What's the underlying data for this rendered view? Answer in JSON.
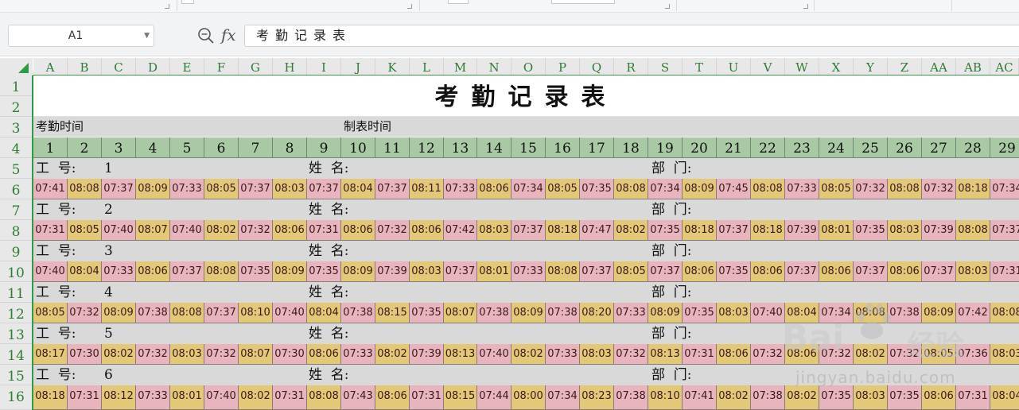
{
  "formula_bar": {
    "cell_ref": "A1",
    "content": "考勤记录表"
  },
  "icons": {
    "zoom": "zoom-in-icon",
    "fx": "function-icon",
    "dropdown": "chevron-down-icon"
  },
  "grid": {
    "columns": [
      "A",
      "B",
      "C",
      "D",
      "E",
      "F",
      "G",
      "H",
      "I",
      "J",
      "K",
      "L",
      "M",
      "N",
      "O",
      "P",
      "Q",
      "R",
      "S",
      "T",
      "U",
      "V",
      "W",
      "X",
      "Y",
      "Z",
      "AA",
      "AB",
      "AC"
    ],
    "rows": [
      "1",
      "2",
      "3",
      "4",
      "5",
      "6",
      "7",
      "8",
      "9",
      "10",
      "11",
      "12",
      "13",
      "14",
      "15",
      "16"
    ]
  },
  "sheet": {
    "title": "考勤记录表",
    "attendance_time_label": "考勤时间",
    "created_time_label": "制表时间",
    "days": [
      "1",
      "2",
      "3",
      "4",
      "5",
      "6",
      "7",
      "8",
      "9",
      "10",
      "11",
      "12",
      "13",
      "14",
      "15",
      "16",
      "17",
      "18",
      "19",
      "20",
      "21",
      "22",
      "23",
      "24",
      "25",
      "26",
      "27",
      "28",
      "29"
    ],
    "id_label": "工  号:",
    "name_label": "姓  名:",
    "dept_label": "部  门:",
    "employees": [
      {
        "id": "1",
        "times": [
          "07:41",
          "08:08",
          "07:37",
          "08:09",
          "07:33",
          "08:05",
          "07:37",
          "08:03",
          "07:37",
          "08:04",
          "07:37",
          "08:11",
          "07:33",
          "08:06",
          "07:34",
          "08:05",
          "07:35",
          "08:08",
          "07:34",
          "08:09",
          "07:45",
          "08:08",
          "07:33",
          "08:05",
          "07:32",
          "08:08",
          "07:32",
          "08:18",
          "07:34"
        ]
      },
      {
        "id": "2",
        "times": [
          "07:31",
          "08:05",
          "07:40",
          "08:07",
          "07:40",
          "08:02",
          "07:32",
          "08:06",
          "07:31",
          "08:06",
          "07:32",
          "08:06",
          "07:42",
          "08:03",
          "07:37",
          "08:18",
          "07:47",
          "08:02",
          "07:35",
          "08:18",
          "07:37",
          "08:18",
          "07:39",
          "08:01",
          "07:35",
          "08:03",
          "07:39",
          "08:08",
          "07:37"
        ]
      },
      {
        "id": "3",
        "times": [
          "07:40",
          "08:04",
          "07:33",
          "08:06",
          "07:37",
          "08:08",
          "07:35",
          "08:09",
          "07:35",
          "08:09",
          "07:39",
          "08:03",
          "07:37",
          "08:01",
          "07:33",
          "08:08",
          "07:37",
          "08:05",
          "07:37",
          "08:06",
          "07:35",
          "08:06",
          "07:37",
          "08:06",
          "07:37",
          "08:06",
          "07:37",
          "08:03",
          "07:31"
        ]
      },
      {
        "id": "4",
        "times": [
          "08:05",
          "07:32",
          "08:09",
          "07:38",
          "08:08",
          "07:37",
          "08:10",
          "07:40",
          "08:04",
          "07:38",
          "08:15",
          "07:35",
          "08:07",
          "07:38",
          "08:09",
          "07:38",
          "08:20",
          "07:33",
          "08:09",
          "07:35",
          "08:03",
          "07:40",
          "08:04",
          "07:34",
          "08:08",
          "07:38",
          "08:09",
          "07:42",
          "08:08"
        ]
      },
      {
        "id": "5",
        "times": [
          "08:17",
          "07:30",
          "08:02",
          "07:32",
          "08:03",
          "07:32",
          "08:07",
          "07:30",
          "08:06",
          "07:33",
          "08:02",
          "07:39",
          "08:13",
          "07:40",
          "08:02",
          "07:33",
          "08:03",
          "07:32",
          "08:13",
          "07:31",
          "08:06",
          "07:32",
          "08:06",
          "07:32",
          "08:02",
          "07:32",
          "08:05",
          "07:36",
          "08:03"
        ]
      },
      {
        "id": "6",
        "times": [
          "08:18",
          "07:31",
          "08:12",
          "07:33",
          "08:01",
          "07:40",
          "08:02",
          "07:31",
          "08:08",
          "07:43",
          "08:06",
          "07:31",
          "08:15",
          "07:44",
          "08:00",
          "07:34",
          "08:23",
          "07:38",
          "08:10",
          "07:41",
          "08:02",
          "07:38",
          "08:02",
          "07:35",
          "08:03",
          "07:35",
          "08:06",
          "07:31",
          "08:04"
        ]
      }
    ]
  },
  "watermark": {
    "brand": "Bai",
    "brand_cn": "经验",
    "url": "jingyan.baidu.com"
  },
  "colors": {
    "accent_green": "#2e9a4a",
    "day_header": "#a9c9a4",
    "late_pink": "#e8b4bd",
    "early_yellow": "#e3c878",
    "band_gray": "#d9d9d9"
  }
}
